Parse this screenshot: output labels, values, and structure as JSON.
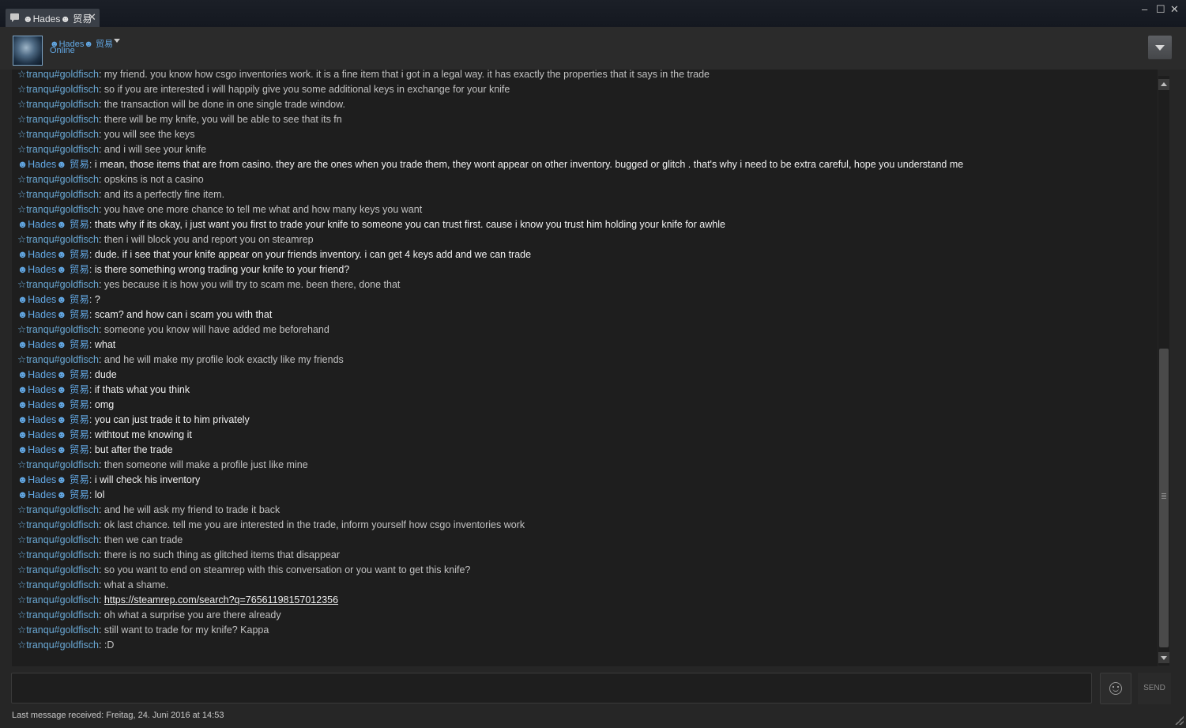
{
  "tab": {
    "label": "☻Hades☻ 贸易"
  },
  "window_controls": {
    "minimize": "–",
    "maximize": "☐",
    "close": "✕"
  },
  "header": {
    "name": "☻Hades☻ 贸易",
    "status": "Online"
  },
  "participants": {
    "tranqu": "☆tranqu#goldfisch",
    "hades": "☻Hades☻ 贸易"
  },
  "messages": [
    {
      "from": "tranqu",
      "text": "my friend. you know how csgo inventories work. it is a fine item that i got in a legal way. it has exactly the properties that it says in the trade"
    },
    {
      "from": "tranqu",
      "text": "so if you are interested i will happily give you some additional keys in exchange for your knife"
    },
    {
      "from": "tranqu",
      "text": "the transaction will be done in one single trade window."
    },
    {
      "from": "tranqu",
      "text": "there will be my knife, you will be able to see that its fn"
    },
    {
      "from": "tranqu",
      "text": "you will see the keys"
    },
    {
      "from": "tranqu",
      "text": "and i will see your knife"
    },
    {
      "from": "hades",
      "text": "i mean, those items that are from casino. they are the ones when you trade them, they wont appear on other inventory. bugged or glitch . that's why i need to be extra careful, hope you understand me"
    },
    {
      "from": "tranqu",
      "text": "opskins is not a casino"
    },
    {
      "from": "tranqu",
      "text": "and its a perfectly fine item."
    },
    {
      "from": "tranqu",
      "text": "you have one more chance to tell me what and how many keys you want"
    },
    {
      "from": "hades",
      "text": "thats why if its okay, i just want you first to trade your knife to someone you can trust first. cause i know you trust him holding your knife for awhle"
    },
    {
      "from": "tranqu",
      "text": "then i will block you and report you on steamrep"
    },
    {
      "from": "hades",
      "text": "dude. if i see that your knife appear on your friends inventory. i can get 4 keys add and we can trade"
    },
    {
      "from": "hades",
      "text": "is there something wrong trading your knife to your friend?"
    },
    {
      "from": "tranqu",
      "text": "yes because it is how you will try to scam me. been there, done that"
    },
    {
      "from": "hades",
      "text": "?"
    },
    {
      "from": "hades",
      "text": "scam? and how can i scam you with that"
    },
    {
      "from": "tranqu",
      "text": "someone you know will have added me beforehand"
    },
    {
      "from": "hades",
      "text": "what"
    },
    {
      "from": "tranqu",
      "text": "and he will make my profile look exactly like my friends"
    },
    {
      "from": "hades",
      "text": "dude"
    },
    {
      "from": "hades",
      "text": "if thats what you think"
    },
    {
      "from": "hades",
      "text": "omg"
    },
    {
      "from": "hades",
      "text": "you can just trade it to him privately"
    },
    {
      "from": "hades",
      "text": "withtout me knowing it"
    },
    {
      "from": "hades",
      "text": "but after the trade"
    },
    {
      "from": "tranqu",
      "text": "then someone will make a profile just like mine"
    },
    {
      "from": "hades",
      "text": "i will check his inventory"
    },
    {
      "from": "hades",
      "text": "lol"
    },
    {
      "from": "tranqu",
      "text": "and he will ask my friend to trade it back"
    },
    {
      "from": "tranqu",
      "text": "ok last chance. tell me you are interested in the trade, inform yourself how csgo inventories work"
    },
    {
      "from": "tranqu",
      "text": "then we can trade"
    },
    {
      "from": "tranqu",
      "text": "there is no such thing as glitched items that disappear"
    },
    {
      "from": "tranqu",
      "text": "so you want to end on steamrep with this conversation or you want to get this knife?"
    },
    {
      "from": "tranqu",
      "text": "what a shame."
    },
    {
      "from": "tranqu",
      "text": "https://steamrep.com/search?q=76561198157012356",
      "link": true
    },
    {
      "from": "tranqu",
      "text": "oh what a surprise you are there already"
    },
    {
      "from": "tranqu",
      "text": "still want to trade for my knife? Kappa"
    },
    {
      "from": "tranqu",
      "text": ":D"
    }
  ],
  "input": {
    "value": "",
    "placeholder": ""
  },
  "icons": {
    "emoticon": "smiley-icon",
    "chat": "chat-bubble-icon"
  },
  "send_label": "SEND",
  "footer": {
    "last_received": "Last message received: Freitag, 24. Juni 2016 at 14:53"
  },
  "colors": {
    "sender": "#62a7e3",
    "text_other": "#f0f0f0",
    "text_self": "#c2c2c2",
    "background": "#1e1e1e"
  }
}
